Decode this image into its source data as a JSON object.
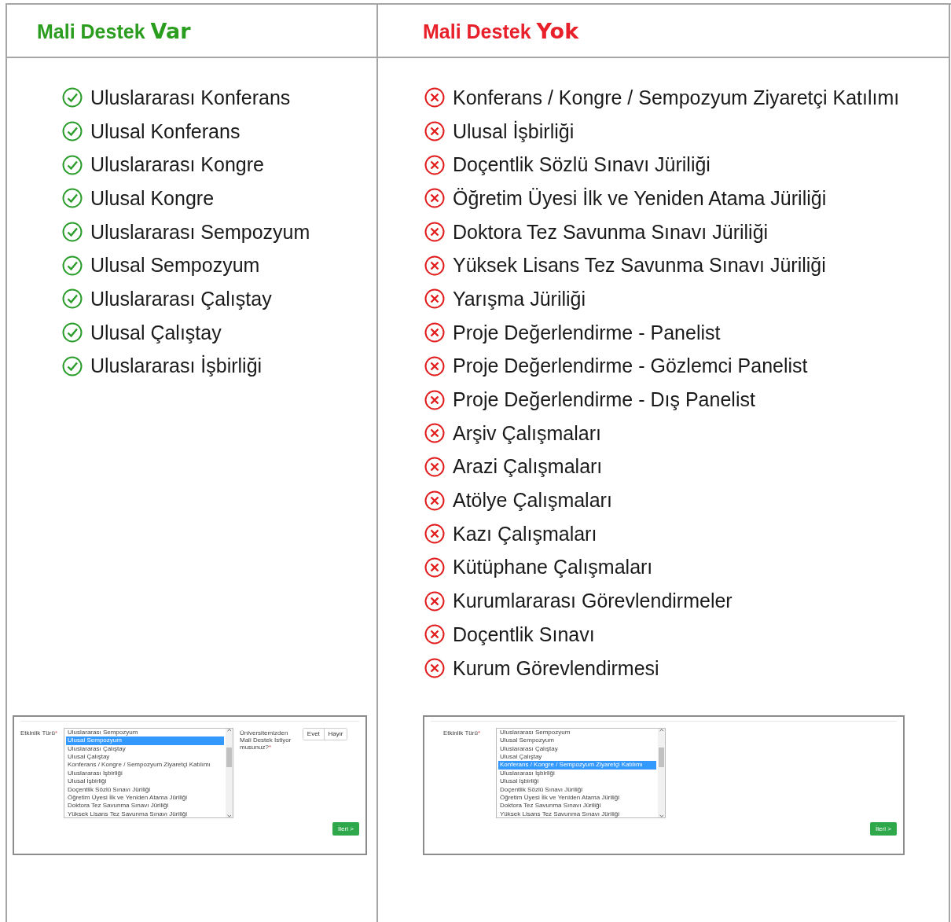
{
  "columns": [
    {
      "kind": "supported",
      "title": "Mali Destek",
      "emphasis": "Var",
      "items": [
        "Uluslararası Konferans",
        "Ulusal Konferans",
        "Uluslararası Kongre",
        "Ulusal Kongre",
        "Uluslararası Sempozyum",
        "Ulusal Sempozyum",
        "Uluslararası Çalıştay",
        "Ulusal Çalıştay",
        "Uluslararası İşbirliği"
      ],
      "screenshot": {
        "field_label": "Etkinlik Türü",
        "required_mark": "*",
        "options": [
          {
            "label": "Uluslararası Sempozyum",
            "selected": false
          },
          {
            "label": "Ulusal Sempozyum",
            "selected": true
          },
          {
            "label": "Uluslararası Çalıştay",
            "selected": false
          },
          {
            "label": "Ulusal Çalıştay",
            "selected": false
          },
          {
            "label": "Konferans / Kongre / Sempozyum Ziyaretçi Katılımı",
            "selected": false
          },
          {
            "label": "Uluslararası İşbirliği",
            "selected": false
          },
          {
            "label": "Ulusal İşbirliği",
            "selected": false
          },
          {
            "label": "Doçentlik Sözlü Sınavı Jüriliği",
            "selected": false
          },
          {
            "label": "Öğretim Üyesi İlk ve Yeniden Atama Jüriliği",
            "selected": false
          },
          {
            "label": "Doktora Tez Savunma Sınavı Jüriliği",
            "selected": false
          },
          {
            "label": "Yüksek Lisans Tez Savunma Sınavı Jüriliği",
            "selected": false
          }
        ],
        "question": {
          "text": "Üniversitemizden Mali Destek İstiyor musunuz?",
          "required_mark": "*",
          "choices": [
            "Evet",
            "Hayır"
          ]
        },
        "next_button": "İleri >"
      }
    },
    {
      "kind": "unsupported",
      "title": "Mali Destek",
      "emphasis": "Yok",
      "items": [
        "Konferans / Kongre / Sempozyum Ziyaretçi Katılımı",
        "Ulusal İşbirliği",
        "Doçentlik Sözlü Sınavı Jüriliği",
        "Öğretim Üyesi İlk ve Yeniden Atama Jüriliği",
        "Doktora Tez Savunma Sınavı Jüriliği",
        "Yüksek Lisans Tez Savunma Sınavı Jüriliği",
        "Yarışma Jüriliği",
        "Proje Değerlendirme - Panelist",
        "Proje Değerlendirme - Gözlemci Panelist",
        "Proje Değerlendirme - Dış Panelist",
        "Arşiv Çalışmaları",
        "Arazi Çalışmaları",
        "Atölye Çalışmaları",
        "Kazı Çalışmaları",
        "Kütüphane Çalışmaları",
        "Kurumlararası Görevlendirmeler",
        "Doçentlik Sınavı",
        "Kurum Görevlendirmesi"
      ],
      "screenshot": {
        "field_label": "Etkinlik Türü",
        "required_mark": "*",
        "options": [
          {
            "label": "Uluslararası Sempozyum",
            "selected": false
          },
          {
            "label": "Ulusal Sempozyum",
            "selected": false
          },
          {
            "label": "Uluslararası Çalıştay",
            "selected": false
          },
          {
            "label": "Ulusal Çalıştay",
            "selected": false
          },
          {
            "label": "Konferans / Kongre / Sempozyum Ziyaretçi Katılımı",
            "selected": true
          },
          {
            "label": "Uluslararası İşbirliği",
            "selected": false
          },
          {
            "label": "Ulusal İşbirliği",
            "selected": false
          },
          {
            "label": "Doçentlik Sözlü Sınavı Jüriliği",
            "selected": false
          },
          {
            "label": "Öğretim Üyesi İlk ve Yeniden Atama Jüriliği",
            "selected": false
          },
          {
            "label": "Doktora Tez Savunma Sınavı Jüriliği",
            "selected": false
          },
          {
            "label": "Yüksek Lisans Tez Savunma Sınavı Jüriliği",
            "selected": false
          }
        ],
        "next_button": "İleri >"
      }
    }
  ]
}
